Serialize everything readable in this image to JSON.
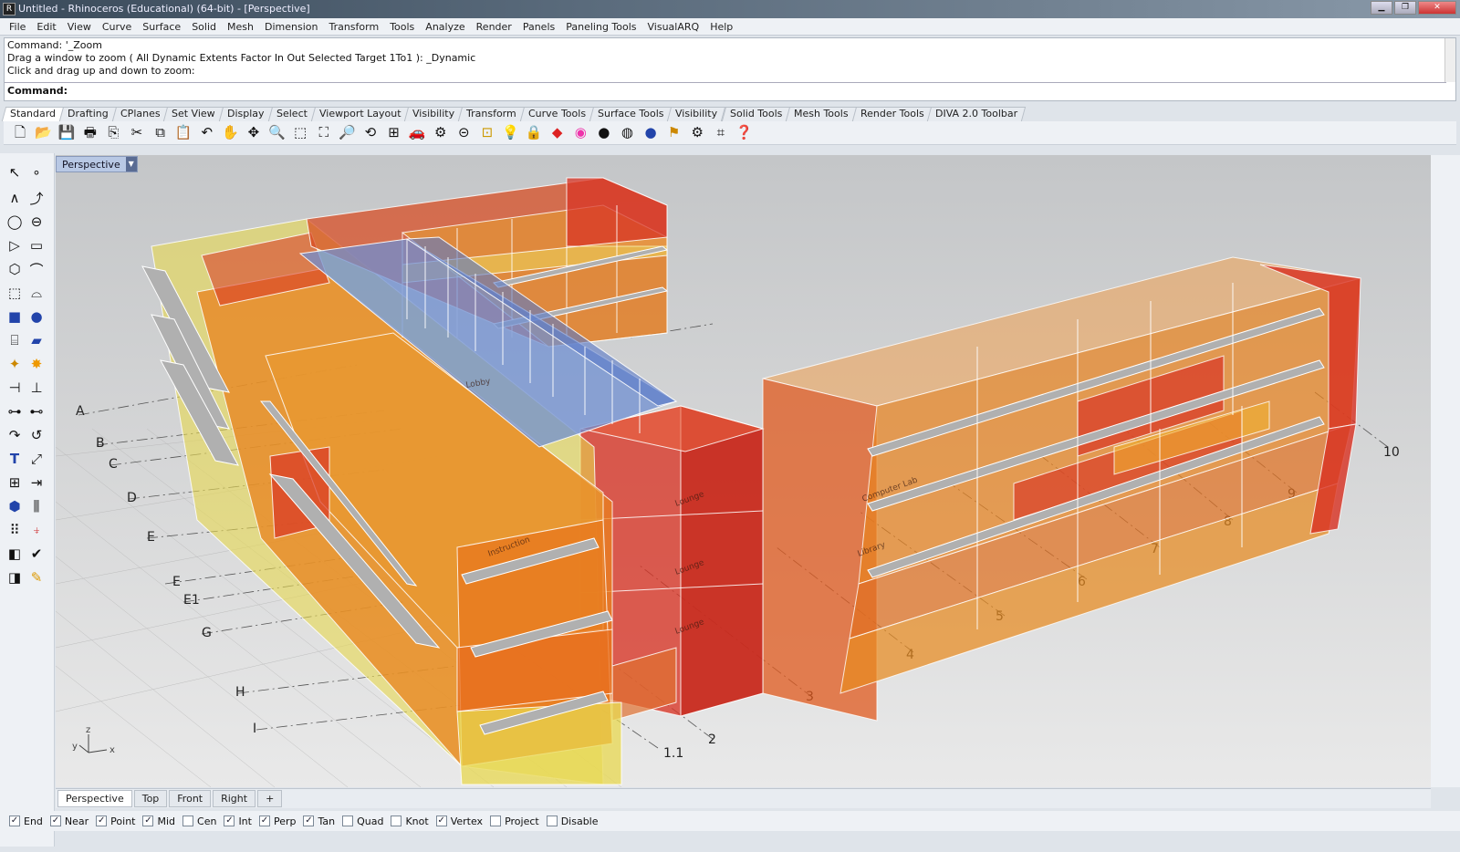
{
  "window": {
    "title": "Untitled - Rhinoceros (Educational) (64-bit) - [Perspective]"
  },
  "menu": [
    "File",
    "Edit",
    "View",
    "Curve",
    "Surface",
    "Solid",
    "Mesh",
    "Dimension",
    "Transform",
    "Tools",
    "Analyze",
    "Render",
    "Panels",
    "Paneling Tools",
    "VisualARQ",
    "Help"
  ],
  "command_history": [
    "Command: '_Zoom",
    "Drag a window to zoom ( All  Dynamic  Extents  Factor  In  Out  Selected  Target  1To1 ): _Dynamic",
    "Click and drag up and down to zoom:"
  ],
  "command_prompt": "Command:",
  "toolbar_tabs": [
    "Standard",
    "Drafting",
    "CPlanes",
    "Set View",
    "Display",
    "Select",
    "Viewport Layout",
    "Visibility",
    "Transform",
    "Curve Tools",
    "Surface Tools",
    "Visibility",
    "Solid Tools",
    "Mesh Tools",
    "Render Tools",
    "DIVA 2.0 Toolbar"
  ],
  "toolbar_icons": [
    "new-icon",
    "open-icon",
    "save-icon",
    "print-icon",
    "import-icon",
    "cut-icon",
    "copy-icon",
    "paste-icon",
    "undo-icon",
    "pan-icon",
    "rotate-icon",
    "zoom-icon",
    "zoom-window-icon",
    "zoom-extents-icon",
    "zoom-selected-icon",
    "rotate-view-icon",
    "viewport-layout-icon",
    "car-icon",
    "properties-icon",
    "ortho-icon",
    "snap-icon",
    "light-icon",
    "lock-icon",
    "layer-icon",
    "color-wheel-icon",
    "shade-icon",
    "render-preview-icon",
    "render-icon",
    "flag-icon",
    "options-icon",
    "grid-icon",
    "help-icon"
  ],
  "left_tools": [
    "select-arrow-icon",
    "point-icon",
    "polyline-icon",
    "curve-icon",
    "circle-icon",
    "ellipse-icon",
    "arc-icon",
    "rectangle-icon",
    "polygon-icon",
    "fillet-icon",
    "surface-icon",
    "sweep-icon",
    "box-icon",
    "sphere-icon",
    "cylinder-icon",
    "extrude-icon",
    "boolean-icon",
    "explode-icon",
    "trim-icon",
    "split-icon",
    "group-icon",
    "join-icon",
    "transform-icon",
    "move-icon",
    "text-icon",
    "dimension-icon",
    "array-icon",
    "mirror-icon",
    "mesh-icon",
    "analyze-icon",
    "grid-array-icon",
    "align-icon",
    "layer-cube-icon",
    "check-icon",
    "render-cube-icon",
    "pencil-icon"
  ],
  "viewport": {
    "active_label": "Perspective",
    "grid_labels": [
      "A",
      "B",
      "C",
      "D",
      "E",
      "E",
      "E1",
      "G",
      "H",
      "I",
      "1.1",
      "2",
      "3",
      "4",
      "5",
      "6",
      "7",
      "8",
      "9",
      "10"
    ],
    "room_labels": [
      "Lounge",
      "Lounge",
      "Lounge",
      "Instruction",
      "Computer Lab",
      "Lobby",
      "Library"
    ],
    "axis": {
      "x": "x",
      "y": "y",
      "z": "z"
    }
  },
  "viewport_tabs": [
    "Perspective",
    "Top",
    "Front",
    "Right",
    "+"
  ],
  "osnaps": [
    {
      "label": "End",
      "checked": true
    },
    {
      "label": "Near",
      "checked": true
    },
    {
      "label": "Point",
      "checked": true
    },
    {
      "label": "Mid",
      "checked": true
    },
    {
      "label": "Cen",
      "checked": false
    },
    {
      "label": "Int",
      "checked": true
    },
    {
      "label": "Perp",
      "checked": true
    },
    {
      "label": "Tan",
      "checked": true
    },
    {
      "label": "Quad",
      "checked": false
    },
    {
      "label": "Knot",
      "checked": false
    },
    {
      "label": "Vertex",
      "checked": true
    },
    {
      "label": "Project",
      "checked": false
    },
    {
      "label": "Disable",
      "checked": false
    }
  ],
  "colors": {
    "orange": "#e87a1e",
    "red": "#d8321a",
    "yellow": "#e8d84a",
    "blue": "#5f7fc4",
    "shelf": "#a8a8a8"
  }
}
